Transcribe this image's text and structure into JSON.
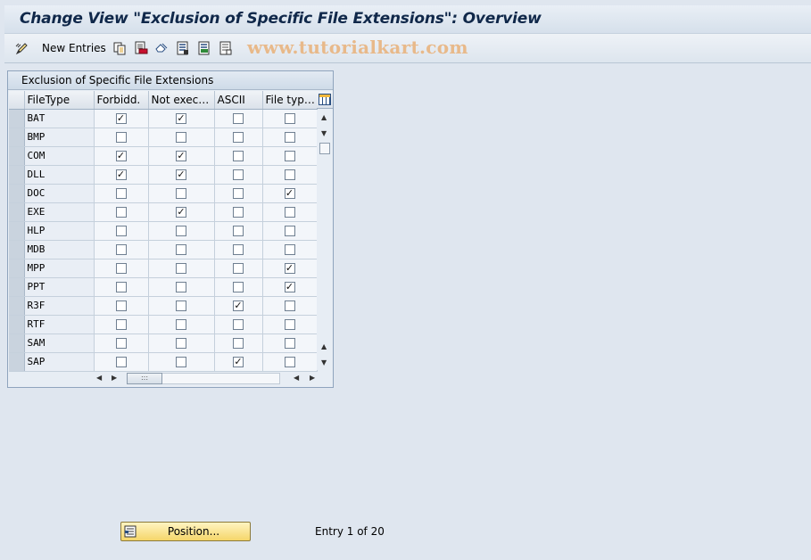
{
  "window": {
    "title": "Change View \"Exclusion of Specific File Extensions\": Overview"
  },
  "toolbar": {
    "new_entries_label": "New Entries",
    "icons": [
      "edit-pencil-icon",
      "copy-icon",
      "delete-icon",
      "undo-icon",
      "select-all-icon",
      "select-block-icon",
      "deselect-all-icon"
    ]
  },
  "watermark": "www.tutorialkart.com",
  "table": {
    "title": "Exclusion of Specific File Extensions",
    "columns": [
      "FileType",
      "Forbidd.",
      "Not execu...",
      "ASCII",
      "File type l..."
    ],
    "rows": [
      {
        "filetype": "BAT",
        "forbidden": true,
        "not_executable": true,
        "ascii": false,
        "file_type_l": false
      },
      {
        "filetype": "BMP",
        "forbidden": false,
        "not_executable": false,
        "ascii": false,
        "file_type_l": false
      },
      {
        "filetype": "COM",
        "forbidden": true,
        "not_executable": true,
        "ascii": false,
        "file_type_l": false
      },
      {
        "filetype": "DLL",
        "forbidden": true,
        "not_executable": true,
        "ascii": false,
        "file_type_l": false
      },
      {
        "filetype": "DOC",
        "forbidden": false,
        "not_executable": false,
        "ascii": false,
        "file_type_l": true
      },
      {
        "filetype": "EXE",
        "forbidden": false,
        "not_executable": true,
        "ascii": false,
        "file_type_l": false
      },
      {
        "filetype": "HLP",
        "forbidden": false,
        "not_executable": false,
        "ascii": false,
        "file_type_l": false
      },
      {
        "filetype": "MDB",
        "forbidden": false,
        "not_executable": false,
        "ascii": false,
        "file_type_l": false
      },
      {
        "filetype": "MPP",
        "forbidden": false,
        "not_executable": false,
        "ascii": false,
        "file_type_l": true
      },
      {
        "filetype": "PPT",
        "forbidden": false,
        "not_executable": false,
        "ascii": false,
        "file_type_l": true
      },
      {
        "filetype": "R3F",
        "forbidden": false,
        "not_executable": false,
        "ascii": true,
        "file_type_l": false
      },
      {
        "filetype": "RTF",
        "forbidden": false,
        "not_executable": false,
        "ascii": false,
        "file_type_l": false
      },
      {
        "filetype": "SAM",
        "forbidden": false,
        "not_executable": false,
        "ascii": false,
        "file_type_l": false
      },
      {
        "filetype": "SAP",
        "forbidden": false,
        "not_executable": false,
        "ascii": true,
        "file_type_l": false
      }
    ]
  },
  "footer": {
    "position_button_label": "Position...",
    "entry_info": "Entry 1 of 20"
  }
}
